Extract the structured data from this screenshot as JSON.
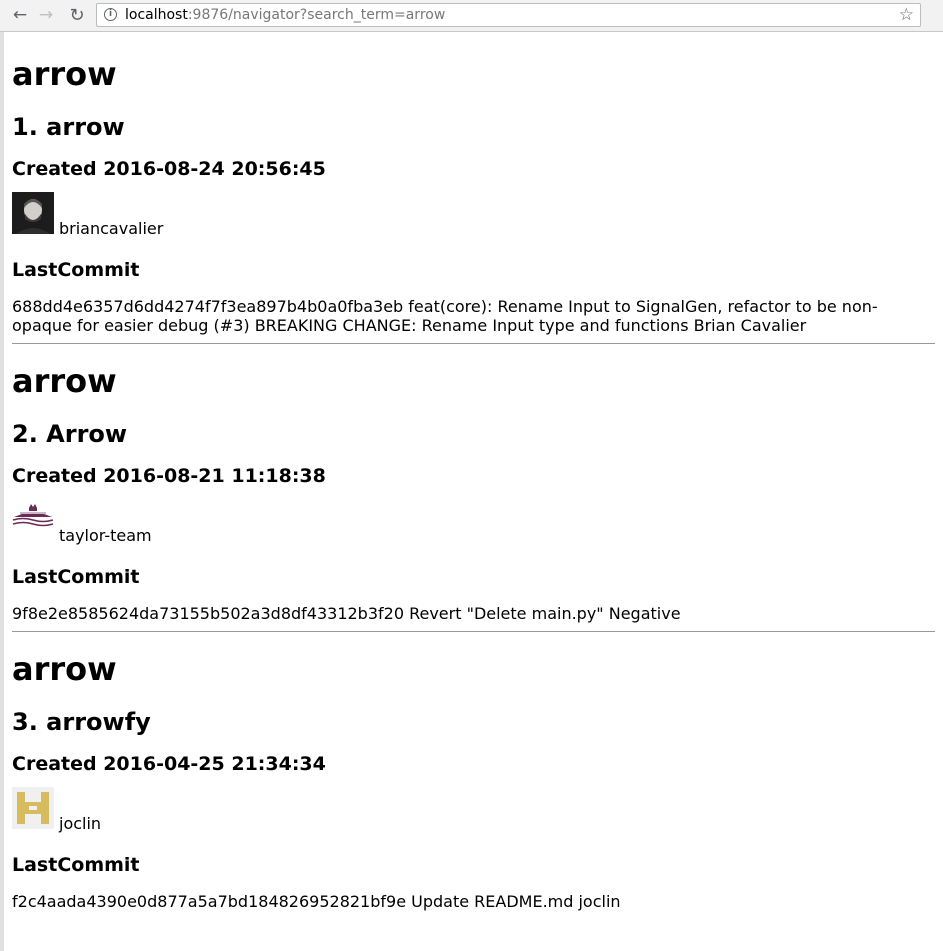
{
  "browser": {
    "url_host": "localhost",
    "url_rest": ":9876/navigator?search_term=arrow"
  },
  "results": [
    {
      "term": "arrow",
      "heading": "1. arrow",
      "created": "Created 2016-08-24 20:56:45",
      "owner": "briancavalier",
      "avatar_style": "photo",
      "last_commit_label": "LastCommit",
      "commit": "688dd4e6357d6dd4274f7f3ea897b4b0a0fba3eb feat(core): Rename Input to SignalGen, refactor to be non-opaque for easier debug (#3) BREAKING CHANGE: Rename Input type and functions Brian Cavalier"
    },
    {
      "term": "arrow",
      "heading": "2. Arrow",
      "created": "Created 2016-08-21 11:18:38",
      "owner": "taylor-team",
      "avatar_style": "logo",
      "last_commit_label": "LastCommit",
      "commit": "9f8e2e8585624da73155b502a3d8df43312b3f20 Revert \"Delete main.py\" Negative"
    },
    {
      "term": "arrow",
      "heading": "3. arrowfy",
      "created": "Created 2016-04-25 21:34:34",
      "owner": "joclin",
      "avatar_style": "identicon",
      "last_commit_label": "LastCommit",
      "commit": "f2c4aada4390e0d877a5a7bd184826952821bf9e Update README.md joclin"
    }
  ],
  "colors": {
    "identicon": "#d6bc5e",
    "identicon_bg": "#f0f0f0",
    "separator": "#999999"
  }
}
